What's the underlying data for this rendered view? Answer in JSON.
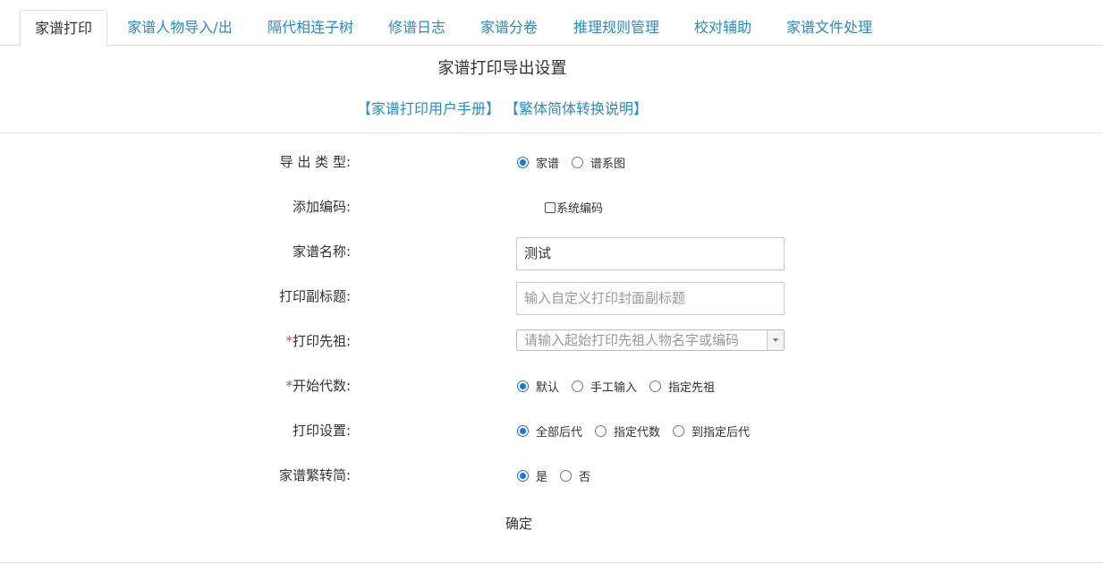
{
  "tabs": [
    {
      "label": "家谱打印",
      "active": true
    },
    {
      "label": "家谱人物导入/出"
    },
    {
      "label": "隔代相连子树"
    },
    {
      "label": "修谱日志"
    },
    {
      "label": "家谱分卷"
    },
    {
      "label": "推理规则管理"
    },
    {
      "label": "校对辅助"
    },
    {
      "label": "家谱文件处理"
    }
  ],
  "page_title": "家谱打印导出设置",
  "links": {
    "manual": "【家谱打印用户手册】",
    "conversion": "【繁体简体转换说明】"
  },
  "form": {
    "export_type": {
      "label": "导 出 类 型:",
      "options": [
        "家谱",
        "谱系图"
      ],
      "selected": "家谱"
    },
    "add_code": {
      "label": "添加编码:",
      "checkbox_label": "系统编码",
      "checked": false
    },
    "genealogy_name": {
      "label": "家谱名称:",
      "value": "测试"
    },
    "subtitle": {
      "label": "打印副标题:",
      "placeholder": "输入自定义打印封面副标题"
    },
    "ancestor": {
      "required_mark": "*",
      "label": "打印先祖:",
      "placeholder": "请输入起始打印先祖人物名字或编码"
    },
    "start_generation": {
      "required_mark": "*",
      "label": "开始代数:",
      "options": [
        "默认",
        "手工输入",
        "指定先祖"
      ],
      "selected": "默认"
    },
    "print_settings": {
      "label": "打印设置:",
      "options": [
        "全部后代",
        "指定代数",
        "到指定后代"
      ],
      "selected": "全部后代"
    },
    "traditional_to_simplified": {
      "label": "家谱繁转简:",
      "options": [
        "是",
        "否"
      ],
      "selected": "是"
    }
  },
  "confirm_label": "确定",
  "colors": {
    "link": "#2a8bc8",
    "radio_accent": "#1a73e8",
    "required": "#e64545"
  }
}
